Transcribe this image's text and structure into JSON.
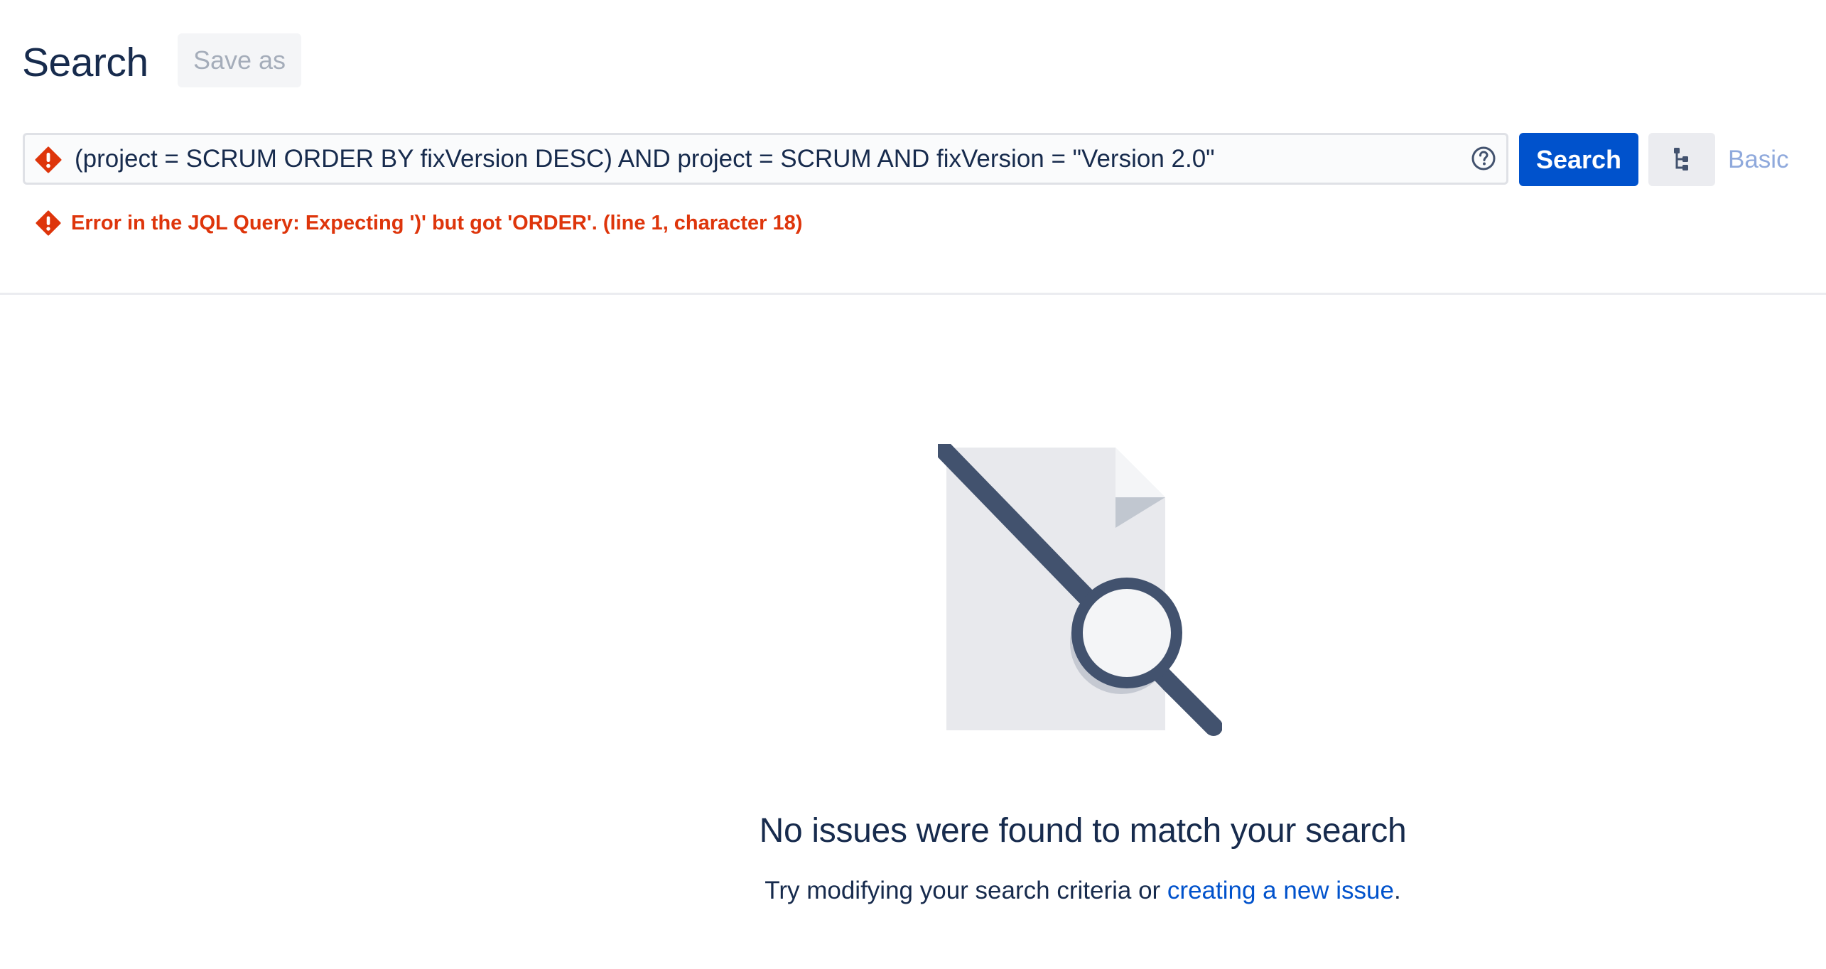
{
  "header": {
    "title": "Search",
    "save_as_label": "Save as"
  },
  "search_bar": {
    "jql_query": "(project = SCRUM ORDER BY fixVersion DESC) AND project = SCRUM AND fixVersion = \"Version 2.0\"",
    "status_icon": "error-icon",
    "help_icon": "help-icon",
    "search_button_label": "Search",
    "structure_icon": "hierarchy-icon",
    "basic_label": "Basic"
  },
  "error": {
    "icon": "error-icon",
    "message": "Error in the JQL Query: Expecting ')' but got 'ORDER'. (line 1, character 18)"
  },
  "empty_state": {
    "illustration": "document-search-icon",
    "title": "No issues were found to match your search",
    "desc_prefix": "Try modifying your search criteria or ",
    "desc_link": "creating a new issue",
    "desc_suffix": "."
  },
  "colors": {
    "primary": "#0052cc",
    "error": "#de350b",
    "text": "#172b4d",
    "disabled_text": "#a5adba"
  }
}
